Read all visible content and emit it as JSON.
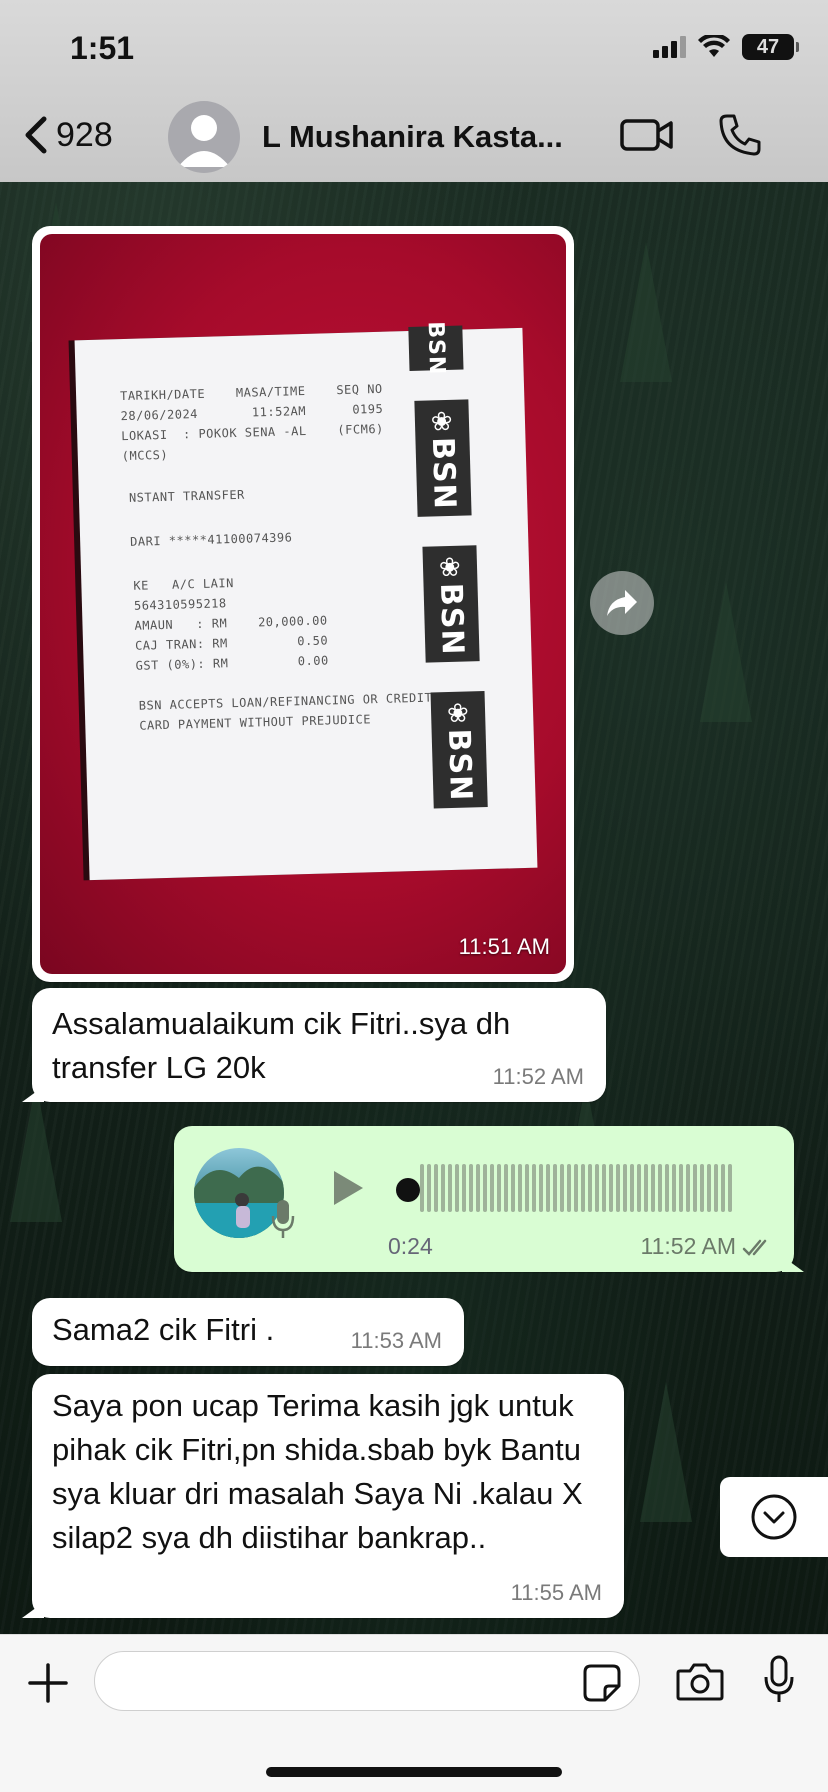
{
  "status_bar": {
    "time": "1:51",
    "battery": "47"
  },
  "header": {
    "back_count": "928",
    "contact_name": "L Mushanira Kasta..."
  },
  "messages": [
    {
      "type": "image",
      "direction": "incoming",
      "time": "11:51 AM",
      "receipt": {
        "lines": [
          "TARIKH/DATE    MASA/TIME    SEQ NO",
          "28/06/2024       11:52AM      0195",
          "LOKASI  : POKOK SENA -AL    (FCM6)",
          "(MCCS)",
          "NSTANT TRANSFER",
          "DARI *****41100074396",
          "KE   A/C LAIN",
          "564310595218",
          "AMAUN   : RM    20,000.00",
          "CAJ TRAN: RM         0.50",
          "GST (0%): RM         0.00",
          "BSN ACCEPTS LOAN/REFINANCING OR CREDIT",
          "CARD PAYMENT WITHOUT PREJUDICE"
        ],
        "brand": "BSN"
      }
    },
    {
      "type": "text",
      "direction": "incoming",
      "text": "Assalamualaikum cik Fitri..sya dh transfer LG 20k",
      "time": "11:52 AM"
    },
    {
      "type": "voice",
      "direction": "outgoing",
      "duration": "0:24",
      "time": "11:52 AM",
      "read": true
    },
    {
      "type": "text",
      "direction": "incoming",
      "text": "Sama2 cik Fitri .",
      "time": "11:53 AM"
    },
    {
      "type": "text",
      "direction": "incoming",
      "text": "Saya pon ucap Terima kasih jgk untuk pihak cik Fitri,pn shida.sbab byk Bantu sya kluar dri masalah Saya Ni .kalau X silap2 sya dh diistihar bankrap..",
      "time": "11:55 AM"
    }
  ],
  "icons": [
    "back-chevron-icon",
    "avatar-placeholder-icon",
    "video-call-icon",
    "phone-icon",
    "forward-icon",
    "play-icon",
    "mic-icon",
    "double-check-icon",
    "chevron-down-icon",
    "plus-icon",
    "sticker-icon",
    "camera-icon"
  ],
  "colors": {
    "outgoing_bubble": "#d9fdd3",
    "incoming_bubble": "#ffffff",
    "header_bg": "#d0d0d0"
  }
}
